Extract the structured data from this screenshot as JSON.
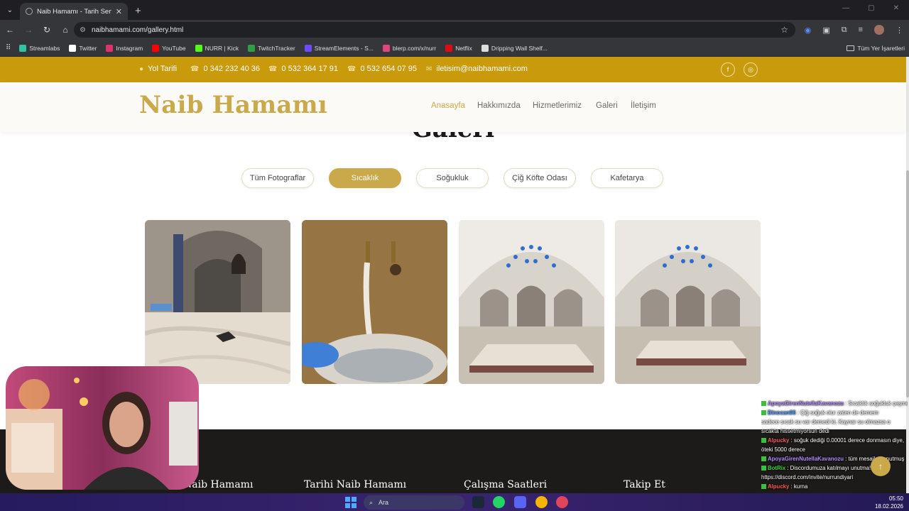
{
  "browser": {
    "tab_title": "Naib Hamamı - Tarih Seni Çağır",
    "url": "naibhamami.com/gallery.html",
    "bookmarks": [
      {
        "label": "Streamlabs",
        "color": "#31c3a2"
      },
      {
        "label": "Twitter",
        "color": "#ffffff"
      },
      {
        "label": "Instagram",
        "color": "#e1306c"
      },
      {
        "label": "YouTube",
        "color": "#ff0000"
      },
      {
        "label": "NURR | Kick",
        "color": "#53fc18"
      },
      {
        "label": "TwitchTracker",
        "color": "#2f9e44"
      },
      {
        "label": "StreamElements - S...",
        "color": "#6d4cff"
      },
      {
        "label": "blerp.com/x/nurr",
        "color": "#e0457b"
      },
      {
        "label": "Netflix",
        "color": "#e50914"
      },
      {
        "label": "Dripping Wall Shelf...",
        "color": "#dddddd"
      }
    ],
    "all_bookmarks": "Tüm Yer İşaretleri"
  },
  "site": {
    "topbar": {
      "directions": "Yol Tarifi",
      "phone1": "0 342 232 40 36",
      "phone2": "0 532 364 17 91",
      "phone3": "0 532 654 07 95",
      "email": "iletisim@naibhamami.com"
    },
    "logo": "Naib Hamamı",
    "nav": {
      "home": "Anasayfa",
      "about": "Hakkımızda",
      "services": "Hizmetlerimiz",
      "gallery": "Galeri",
      "contact": "İletişim"
    },
    "heading": "Galeri",
    "filters": [
      "Tüm Fotograflar",
      "Sıcaklık",
      "Soğukluk",
      "Çiğ Köfte Odası",
      "Kafetarya"
    ],
    "active_filter": "Sıcaklık",
    "footer": {
      "col1": "Naib Hamamı",
      "col2": "Tarihi Naib Hamamı",
      "col3": "Çalışma Saatleri",
      "col4": "Takip Et"
    },
    "accent_color": "#c9a94a",
    "topbar_color": "#c99a0b"
  },
  "chat": [
    {
      "user": "ApoyaGirenNutellaKavanozu",
      "msg": "Sıcaklık soğukluk çeşme türü var işte aq",
      "cls": "u1"
    },
    {
      "user": "Dinocan06",
      "msg": "Çiğ soğuk olur zaten de demem",
      "cls": "u2"
    },
    {
      "user": "",
      "msg": "sadece sıcak su var demedi ki. Kaynar su olmazsa o sıcakta hissetmiyorsun dedi",
      "cls": ""
    },
    {
      "user": "Alpucky",
      "msg": "soğuk dediği 0.00001 derece donmasın diye, öteki 5000 derece",
      "cls": "u3"
    },
    {
      "user": "ApoyaGirenNutellaKavanozu",
      "msg": "tüm mesajları unutmuş",
      "cls": "u1"
    },
    {
      "user": "BotRix",
      "msg": "Discordumuza katılmayı unutma!!! https://discord.com/invite/nurrundiyari",
      "cls": "u4"
    },
    {
      "user": "Alpucky",
      "msg": "kurna",
      "cls": "u3"
    }
  ],
  "taskbar": {
    "search": "Ara",
    "time": "05:50",
    "date": "18.02.2026"
  }
}
